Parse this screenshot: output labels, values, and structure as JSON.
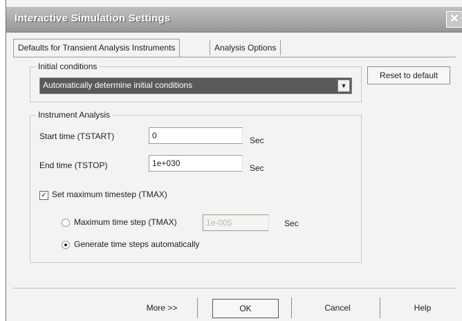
{
  "window": {
    "title": "Interactive Simulation Settings",
    "close_glyph": "✕"
  },
  "tabs": [
    {
      "label": "Defaults for Transient Analysis Instruments",
      "active": true
    },
    {
      "label": "Analysis Options",
      "active": false
    }
  ],
  "initial_conditions": {
    "group_label": "Initial conditions",
    "selected": "Automatically determine initial conditions"
  },
  "reset_button": {
    "label": "Reset to default"
  },
  "instrument_analysis": {
    "group_label": "Instrument Analysis",
    "start_time": {
      "label": "Start time (TSTART)",
      "value": "0",
      "unit": "Sec"
    },
    "end_time": {
      "label": "End time (TSTOP)",
      "value": "1e+030",
      "unit": "Sec"
    },
    "set_max_timestep": {
      "label": "Set maximum timestep (TMAX)",
      "checked": true
    },
    "max_time_step": {
      "label": "Maximum time step (TMAX)",
      "value": "1e-005",
      "unit": "Sec",
      "selected": false
    },
    "auto_time_steps": {
      "label": "Generate time steps automatically",
      "selected": true
    }
  },
  "footer": {
    "more_label": "More >>",
    "ok_label": "OK",
    "cancel_label": "Cancel",
    "help_label": "Help"
  }
}
